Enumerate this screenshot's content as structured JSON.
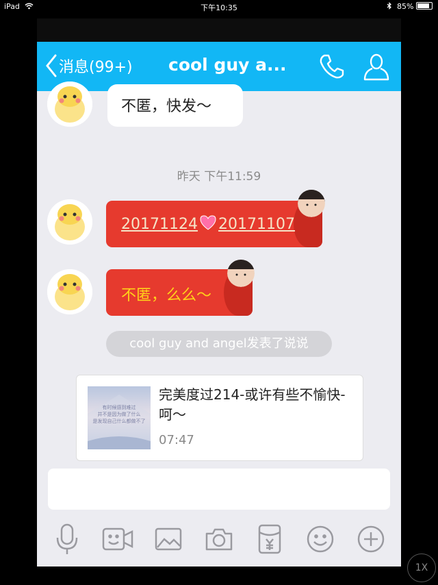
{
  "status_bar": {
    "device": "iPad",
    "time": "下午10:35",
    "battery": "85%",
    "battery_level": 0.85
  },
  "header": {
    "back_label": "消息(99+)",
    "title": "cool guy a..."
  },
  "messages": {
    "bubble1_text": "不匿，快发～",
    "timestamp": "昨天 下午11:59",
    "redpacket1": {
      "part1": "20171124",
      "part2": "20171107"
    },
    "redpacket2_text": "不匿，么么～",
    "system_notice": "cool guy and angel发表了说说"
  },
  "post_card": {
    "thumb_lines": [
      "有时候感到难过",
      "并不是因为做了什么",
      "是发现自己什么都做不了"
    ],
    "text": "完美度过214-或许有些不愉快-呵～",
    "time": "07:47"
  },
  "overlay": {
    "zoom": "1X"
  },
  "colors": {
    "nav_bg": "#12b7f5",
    "redpacket": "#e63a2e",
    "chat_bg": "#ececf1"
  },
  "icons": [
    "wifi-icon",
    "bluetooth-icon",
    "back-chevron-icon",
    "phone-icon",
    "profile-icon",
    "microphone-icon",
    "video-icon",
    "image-icon",
    "camera-icon",
    "red-packet-icon",
    "emoji-icon",
    "plus-icon",
    "heart-emoji-icon"
  ]
}
